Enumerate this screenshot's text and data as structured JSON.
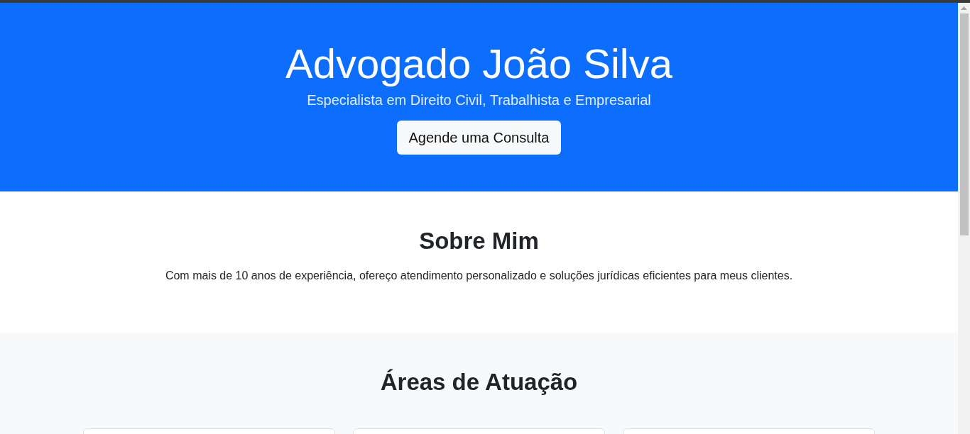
{
  "hero": {
    "title": "Advogado João Silva",
    "subtitle": "Especialista em Direito Civil, Trabalhista e Empresarial",
    "button": "Agende uma Consulta"
  },
  "about": {
    "heading": "Sobre Mim",
    "text": "Com mais de 10 anos de experiência, ofereço atendimento personalizado e soluções jurídicas eficientes para meus clientes."
  },
  "areas": {
    "heading": "Áreas de Atuação"
  }
}
